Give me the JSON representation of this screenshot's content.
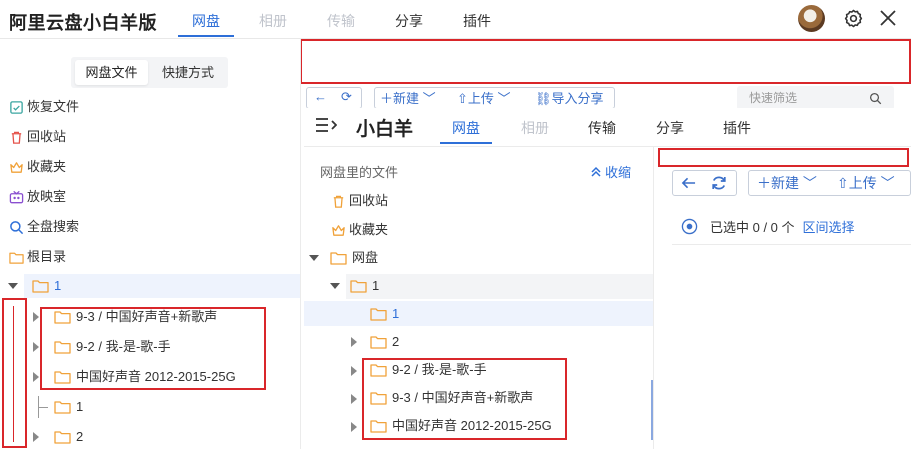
{
  "app": {
    "title": "阿里云盘小白羊版"
  },
  "outer_nav": {
    "tabs": [
      "网盘",
      "相册",
      "传输",
      "分享",
      "插件"
    ]
  },
  "outer_sidebar": {
    "segments": [
      "网盘文件",
      "快捷方式"
    ],
    "items": [
      {
        "label": "恢复文件",
        "icon": "restore-icon"
      },
      {
        "label": "回收站",
        "icon": "trash-icon"
      },
      {
        "label": "收藏夹",
        "icon": "crown-icon"
      },
      {
        "label": "放映室",
        "icon": "tv-icon"
      },
      {
        "label": "全盘搜索",
        "icon": "search-icon"
      },
      {
        "label": "根目录",
        "icon": "folder-icon"
      }
    ],
    "tree": [
      "1",
      "9-3 / 中国好声音+新歌声",
      "9-2 / 我-是-歌-手",
      "中国好声音 2012-2015-25G",
      "1",
      "2"
    ]
  },
  "outer_toolbar": {
    "new_label": "新建",
    "upload_label": "上传",
    "import_label": "导入分享",
    "filter_placeholder": "快速筛选"
  },
  "inner": {
    "title": "小白羊",
    "tabs": [
      "网盘",
      "相册",
      "传输",
      "分享",
      "插件"
    ],
    "section_label": "网盘里的文件",
    "collapse_label": "收缩",
    "items": [
      {
        "label": "回收站",
        "icon": "trash-icon"
      },
      {
        "label": "收藏夹",
        "icon": "crown-icon"
      }
    ],
    "tree": [
      "网盘",
      "1",
      "1",
      "2",
      "9-2 / 我-是-歌-手",
      "9-3 / 中国好声音+新歌声",
      "中国好声音 2012-2015-25G"
    ],
    "toolbar": {
      "new_label": "新建",
      "upload_label": "上传"
    },
    "selection": {
      "text": "已选中 0 / 0 个",
      "range_label": "区间选择"
    }
  },
  "colors": {
    "accent": "#2e6fd8",
    "highlight": "#d9262a",
    "folder": "#f0a23a"
  }
}
